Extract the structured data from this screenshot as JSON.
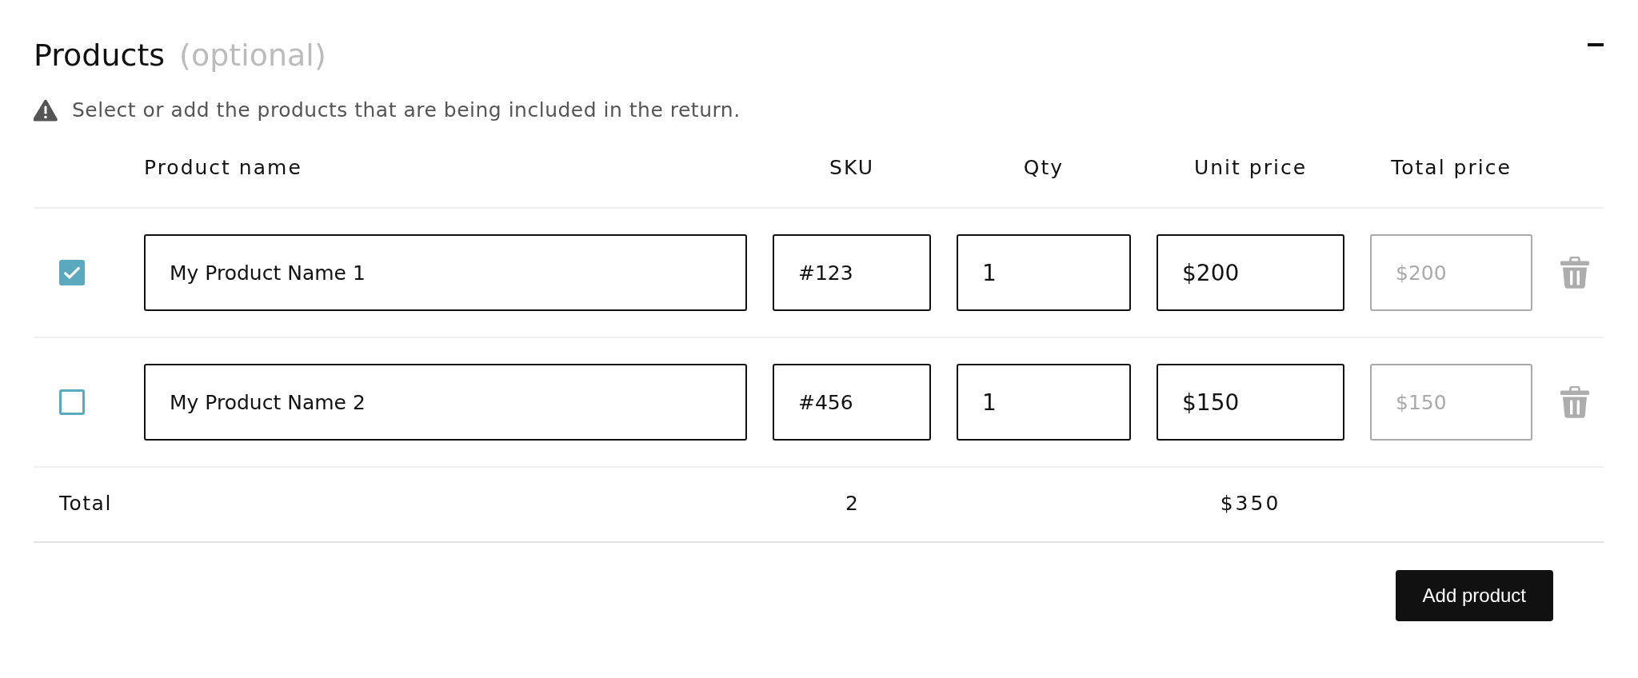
{
  "section": {
    "title": "Products",
    "title_note": "(optional)",
    "expanded": true
  },
  "notice": {
    "text": "Select or add the products that are being included in the return."
  },
  "table": {
    "columns": [
      "Product name",
      "SKU",
      "Qty",
      "Unit price",
      "Total price"
    ],
    "rows": [
      {
        "checked": true,
        "cells": [
          {
            "value": "My Product Name 1",
            "disabled": false
          },
          {
            "value": "#123",
            "disabled": false
          },
          {
            "value": "1",
            "disabled": false
          },
          {
            "value": "$200",
            "disabled": false
          },
          {
            "value": "$200",
            "disabled": true
          }
        ]
      },
      {
        "checked": false,
        "cells": [
          {
            "value": "My Product Name 2",
            "disabled": false
          },
          {
            "value": "#456",
            "disabled": false
          },
          {
            "value": "1",
            "disabled": false
          },
          {
            "value": "$150",
            "disabled": false
          },
          {
            "value": "$150",
            "disabled": true
          }
        ]
      }
    ],
    "totals": {
      "label": "Total",
      "quantity": "2",
      "amount": "$350"
    }
  },
  "add_button": {
    "label": "Add product"
  }
}
